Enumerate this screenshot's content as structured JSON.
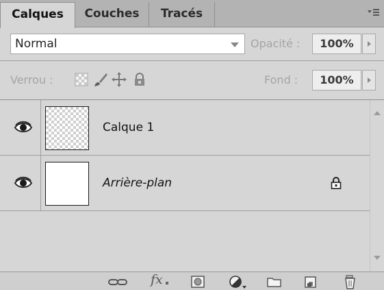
{
  "tabs": [
    {
      "label": "Calques",
      "active": true
    },
    {
      "label": "Couches",
      "active": false
    },
    {
      "label": "Tracés",
      "active": false
    }
  ],
  "blend": {
    "mode": "Normal",
    "opacity_label": "Opacité :",
    "opacity_value": "100%"
  },
  "lock": {
    "label": "Verrou :",
    "fill_label": "Fond :",
    "fill_value": "100%"
  },
  "layers": [
    {
      "name": "Calque 1",
      "visible": true,
      "thumbnail": "transparent",
      "locked": false,
      "italic": false
    },
    {
      "name": "Arrière-plan",
      "visible": true,
      "thumbnail": "white",
      "locked": true,
      "italic": true
    }
  ],
  "footer": {
    "fx_label": "fx"
  },
  "icons": {
    "panel_menu": "panel-menu-icon",
    "lock_transparent": "lock-transparent-pixels-icon",
    "lock_image": "lock-image-pixels-icon",
    "lock_position": "lock-position-icon",
    "lock_all": "lock-all-icon",
    "eye": "eye-icon",
    "link": "link-layers-icon",
    "mask": "add-mask-icon",
    "adjustment": "adjustment-layer-icon",
    "group": "new-group-icon",
    "new_layer": "new-layer-icon",
    "delete": "trash-icon"
  },
  "colors": {
    "panel_bg": "#d6d6d6",
    "tabbar_bg": "#b3b3b3",
    "disabled_text": "#a4a4a4"
  }
}
